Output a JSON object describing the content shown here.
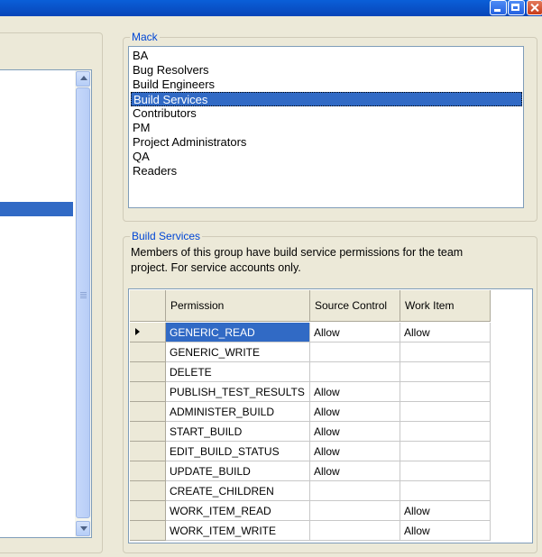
{
  "groups_box": {
    "title": "Mack",
    "items": [
      "BA",
      "Bug Resolvers",
      "Build Engineers",
      "Build Services",
      "Contributors",
      "PM",
      "Project Administrators",
      "QA",
      "Readers"
    ],
    "selected_index": 3
  },
  "detail_box": {
    "title": "Build Services",
    "description": "Members of this group have build service permissions for the team project. For service accounts only."
  },
  "permissions_grid": {
    "columns": [
      "Permission",
      "Source Control",
      "Work Item"
    ],
    "rows": [
      {
        "permission": "GENERIC_READ",
        "source_control": "Allow",
        "work_item": "Allow"
      },
      {
        "permission": "GENERIC_WRITE",
        "source_control": "",
        "work_item": ""
      },
      {
        "permission": "DELETE",
        "source_control": "",
        "work_item": ""
      },
      {
        "permission": "PUBLISH_TEST_RESULTS",
        "source_control": "Allow",
        "work_item": ""
      },
      {
        "permission": "ADMINISTER_BUILD",
        "source_control": "Allow",
        "work_item": ""
      },
      {
        "permission": "START_BUILD",
        "source_control": "Allow",
        "work_item": ""
      },
      {
        "permission": "EDIT_BUILD_STATUS",
        "source_control": "Allow",
        "work_item": ""
      },
      {
        "permission": "UPDATE_BUILD",
        "source_control": "Allow",
        "work_item": ""
      },
      {
        "permission": "CREATE_CHILDREN",
        "source_control": "",
        "work_item": ""
      },
      {
        "permission": "WORK_ITEM_READ",
        "source_control": "",
        "work_item": "Allow"
      },
      {
        "permission": "WORK_ITEM_WRITE",
        "source_control": "",
        "work_item": "Allow"
      }
    ],
    "current_row": 0
  },
  "icons": {
    "minimize": "minimize-icon",
    "maximize": "maximize-icon",
    "close": "close-icon",
    "row_pointer": "row-pointer-icon"
  },
  "colors": {
    "selection": "#316ac5",
    "group_title": "#0046d5",
    "dialog_bg": "#ece9d8"
  }
}
